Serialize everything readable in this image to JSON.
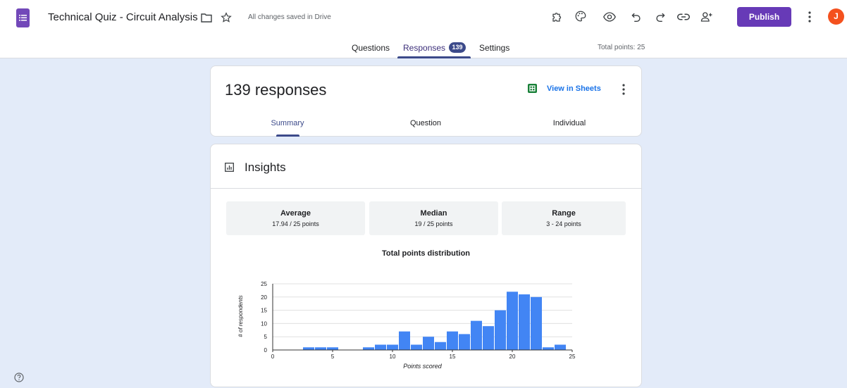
{
  "app": {
    "title": "Technical Quiz - Circuit Analysis",
    "save_status": "All changes saved in Drive",
    "publish_label": "Publish",
    "avatar_initial": "J",
    "toolbar_icons": [
      "addons-icon",
      "palette-icon",
      "preview-icon",
      "undo-icon",
      "redo-icon",
      "link-icon",
      "add-collaborator-icon",
      "more-vert-icon"
    ]
  },
  "tabs": {
    "questions": "Questions",
    "responses": "Responses",
    "responses_count": "139",
    "settings": "Settings",
    "total_points": "Total points: 25"
  },
  "responses_card": {
    "count_label": "139 responses",
    "view_in_sheets": "View in Sheets",
    "sub_tabs": {
      "summary": "Summary",
      "question": "Question",
      "individual": "Individual"
    }
  },
  "insights": {
    "title": "Insights",
    "stats": [
      {
        "label": "Average",
        "value": "17.94 / 25 points"
      },
      {
        "label": "Median",
        "value": "19 / 25 points"
      },
      {
        "label": "Range",
        "value": "3 - 24 points"
      }
    ]
  },
  "chart_data": {
    "type": "bar",
    "title": "Total points distribution",
    "xlabel": "Points scored",
    "ylabel": "# of respondents",
    "x": [
      3,
      4,
      5,
      8,
      9,
      10,
      11,
      12,
      13,
      14,
      15,
      16,
      17,
      18,
      19,
      20,
      21,
      22,
      23,
      24
    ],
    "values": [
      1,
      1,
      1,
      1,
      2,
      2,
      7,
      2,
      5,
      3,
      7,
      6,
      11,
      9,
      15,
      22,
      21,
      20,
      1,
      2
    ],
    "xlim": [
      0,
      25
    ],
    "ylim": [
      0,
      25
    ],
    "xticks": [
      0,
      5,
      10,
      15,
      20,
      25
    ],
    "yticks": [
      0,
      5,
      10,
      15,
      20,
      25
    ],
    "grid": true,
    "bar_color": "#4285f4"
  },
  "colors": {
    "accent": "#673ab7",
    "tab_active": "#3c4a8a",
    "background": "#e3ebf9",
    "avatar": "#f4511e",
    "sheets": "#188038"
  }
}
